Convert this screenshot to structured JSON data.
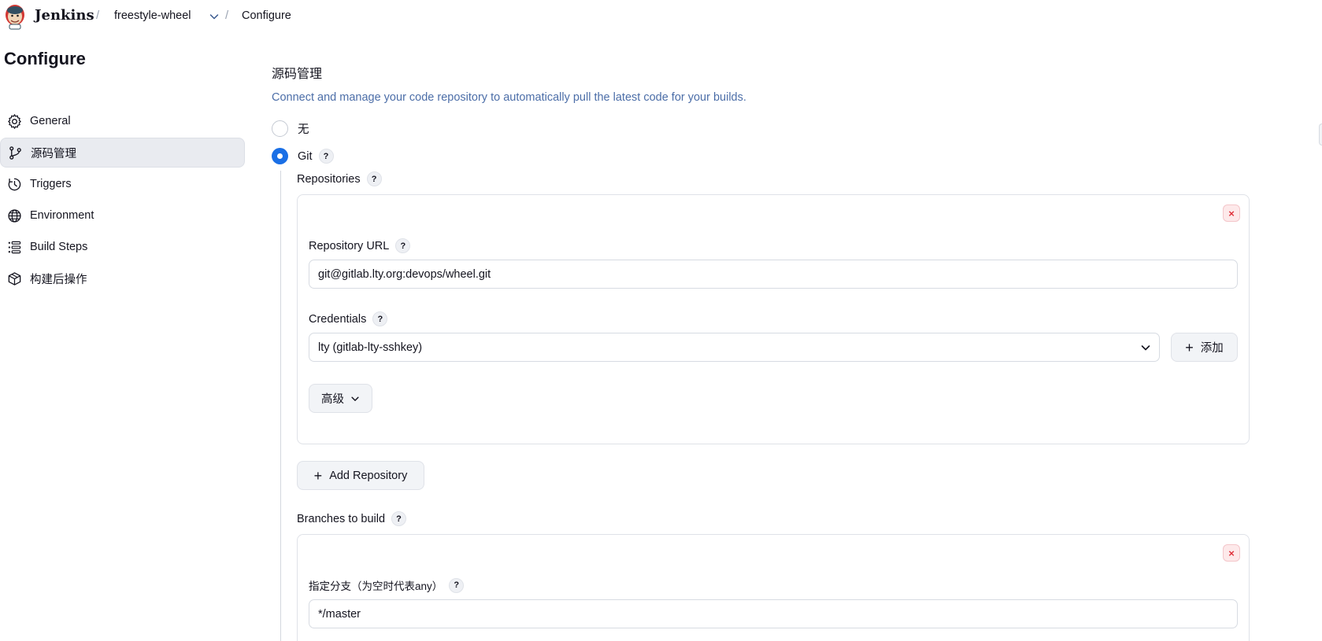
{
  "header": {
    "brand": "Jenkins",
    "crumbs": [
      "freestyle-wheel",
      "Configure"
    ],
    "separator": "/"
  },
  "sidebar": {
    "title": "Configure",
    "items": [
      {
        "label": "General",
        "icon": "gear-icon",
        "active": false
      },
      {
        "label": "源码管理",
        "icon": "branch-icon",
        "active": true
      },
      {
        "label": "Triggers",
        "icon": "clock-icon",
        "active": false
      },
      {
        "label": "Environment",
        "icon": "globe-icon",
        "active": false
      },
      {
        "label": "Build Steps",
        "icon": "list-icon",
        "active": false
      },
      {
        "label": "构建后操作",
        "icon": "cube-icon",
        "active": false
      }
    ]
  },
  "scm": {
    "title": "源码管理",
    "description": "Connect and manage your code repository to automatically pull the latest code for your builds.",
    "options": [
      {
        "label": "无",
        "checked": false
      },
      {
        "label": "Git",
        "checked": true
      }
    ],
    "help": "?"
  },
  "repositories": {
    "label": "Repositories",
    "close": "×",
    "url_label": "Repository URL",
    "url_value": "git@gitlab.lty.org:devops/wheel.git",
    "credentials_label": "Credentials",
    "credentials_value": "lty (gitlab-lty-sshkey)",
    "add_label": "添加",
    "advanced_label": "高级",
    "add_repository_label": "Add Repository"
  },
  "branches": {
    "label": "Branches to build",
    "close": "×",
    "spec_label": "指定分支（为空时代表any）",
    "spec_value": "*/master"
  },
  "colors": {
    "accent": "#1a6fe6",
    "description": "#4c6ea8",
    "danger": "#e0323c"
  }
}
